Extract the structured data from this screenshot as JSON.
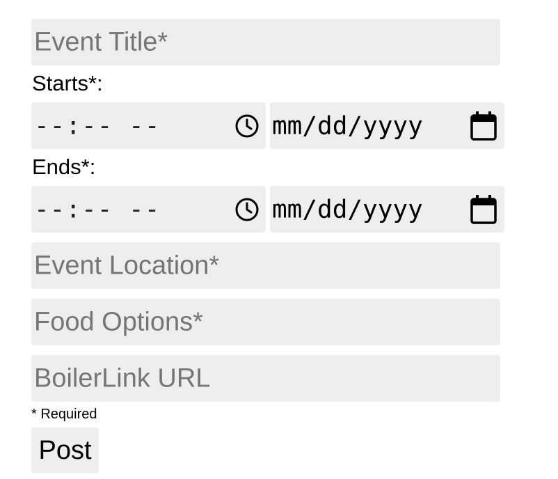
{
  "form": {
    "title_placeholder": "Event Title*",
    "starts_label": "Starts*:",
    "starts_time_placeholder": "--:-- --",
    "starts_date_placeholder": "mm/dd/yyyy",
    "ends_label": "Ends*:",
    "ends_time_placeholder": "--:-- --",
    "ends_date_placeholder": "mm/dd/yyyy",
    "location_placeholder": "Event Location*",
    "food_placeholder": "Food Options*",
    "boilerlink_placeholder": "BoilerLink URL",
    "required_note": "* Required",
    "post_label": "Post"
  },
  "icons": {
    "time": "clock-icon",
    "date": "calendar-icon"
  }
}
